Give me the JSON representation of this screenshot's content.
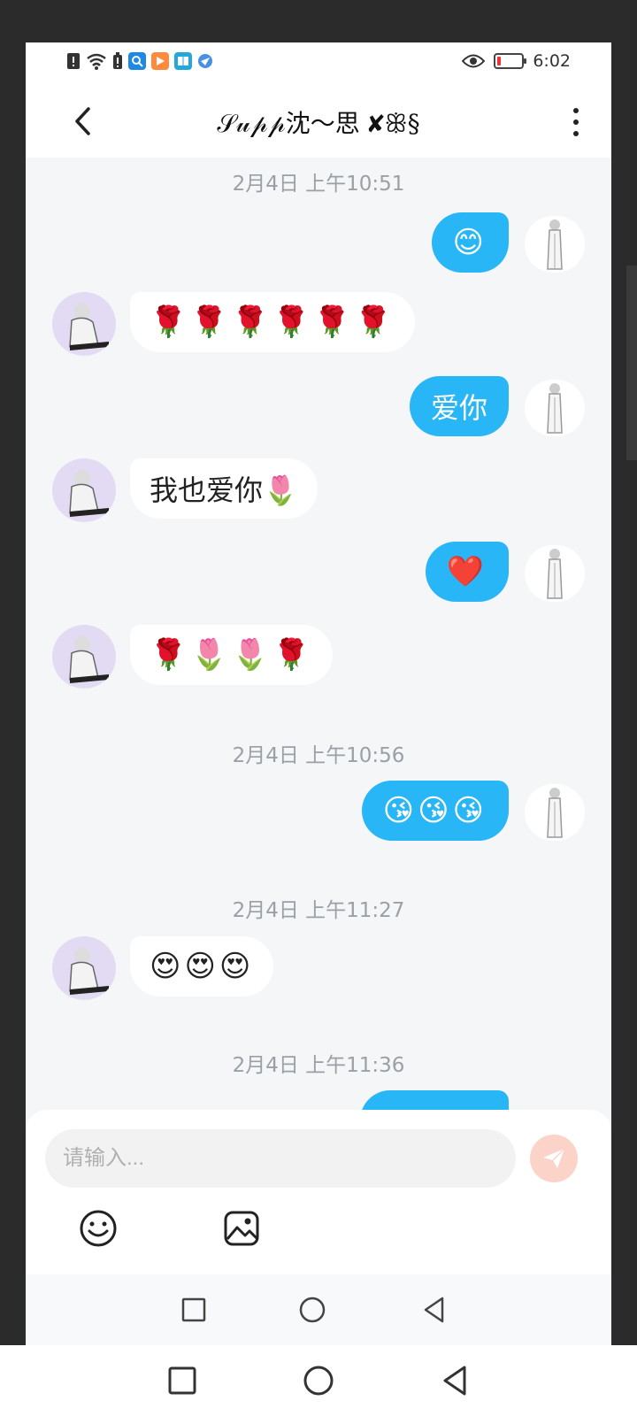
{
  "status_bar": {
    "time": "6:02",
    "notification_icons": [
      "alert-icon",
      "wifi-icon",
      "battery-alert-icon",
      "search-app-icon",
      "video-app-icon",
      "book-app-icon",
      "browser-app-icon"
    ],
    "eye_icon": "eye-icon",
    "battery_level": 0.1
  },
  "header": {
    "title": "𝒮𝓊𝓅𝓅沈～思 ✘ꕥ§",
    "back_icon": "chevron-left-icon",
    "more_icon": "more-vertical-icon"
  },
  "messages": [
    {
      "type": "timestamp",
      "text": "2月4日 上午10:51"
    },
    {
      "type": "out",
      "text": "😊"
    },
    {
      "type": "in",
      "text": "🌹🌹🌹🌹🌹🌹"
    },
    {
      "type": "out",
      "text": "爱你"
    },
    {
      "type": "in",
      "text": "我也爱你🌷"
    },
    {
      "type": "out",
      "text": "❤️"
    },
    {
      "type": "in",
      "text": "🌹🌷🌷🌹"
    },
    {
      "type": "timestamp",
      "text": "2月4日 上午10:56"
    },
    {
      "type": "out",
      "text": "😘😘😘"
    },
    {
      "type": "timestamp",
      "text": "2月4日 上午11:27"
    },
    {
      "type": "in",
      "text": "😍😍😍"
    },
    {
      "type": "timestamp",
      "text": "2月4日 上午11:36"
    }
  ],
  "input": {
    "placeholder": "请输入...",
    "value": ""
  },
  "toolbar": {
    "emoji_icon": "smiley-icon",
    "image_icon": "image-icon",
    "send_icon": "send-icon"
  },
  "colors": {
    "outgoing_bubble": "#29b6f6",
    "incoming_bubble": "#ffffff",
    "chat_background": "#f4f6f8",
    "send_button": "#fbd3c8"
  }
}
